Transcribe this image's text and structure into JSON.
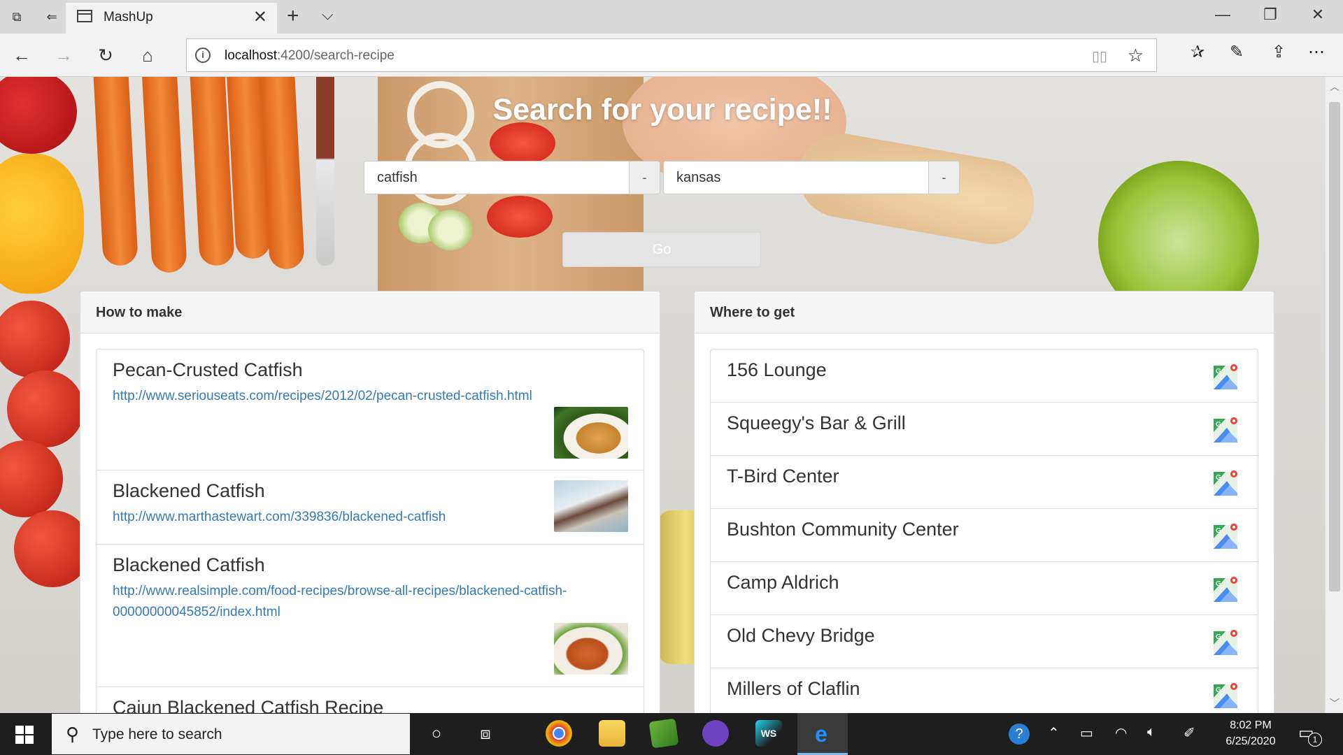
{
  "browser": {
    "tab_title": "MashUp",
    "url_host": "localhost",
    "url_rest": ":4200/search-recipe"
  },
  "page": {
    "title": "Search for your recipe!!",
    "recipe_input": {
      "value": "catfish"
    },
    "location_input": {
      "value": "kansas"
    },
    "clear_label": "-",
    "go_label": "Go"
  },
  "how_to_make": {
    "heading": "How to make",
    "recipes": [
      {
        "title": "Pecan-Crusted Catfish",
        "url": "http://www.seriouseats.com/recipes/2012/02/pecan-crusted-catfish.html"
      },
      {
        "title": "Blackened Catfish",
        "url": "http://www.marthastewart.com/339836/blackened-catfish"
      },
      {
        "title": "Blackened Catfish",
        "url": "http://www.realsimple.com/food-recipes/browse-all-recipes/blackened-catfish-00000000045852/index.html"
      },
      {
        "title": "Cajun Blackened Catfish Recipe",
        "url": ""
      }
    ]
  },
  "where_to_get": {
    "heading": "Where to get",
    "places": [
      {
        "name": "156 Lounge"
      },
      {
        "name": "Squeegy's Bar & Grill"
      },
      {
        "name": "T-Bird Center"
      },
      {
        "name": "Bushton Community Center"
      },
      {
        "name": "Camp Aldrich"
      },
      {
        "name": "Old Chevy Bridge"
      },
      {
        "name": "Millers of Claflin"
      }
    ]
  },
  "taskbar": {
    "search_placeholder": "Type here to search",
    "time": "8:02 PM",
    "date": "6/25/2020",
    "notification_count": "1"
  },
  "colors": {
    "link": "#337ab7",
    "taskbar": "#1e1e1e",
    "edge_blue": "#1e90ff"
  }
}
